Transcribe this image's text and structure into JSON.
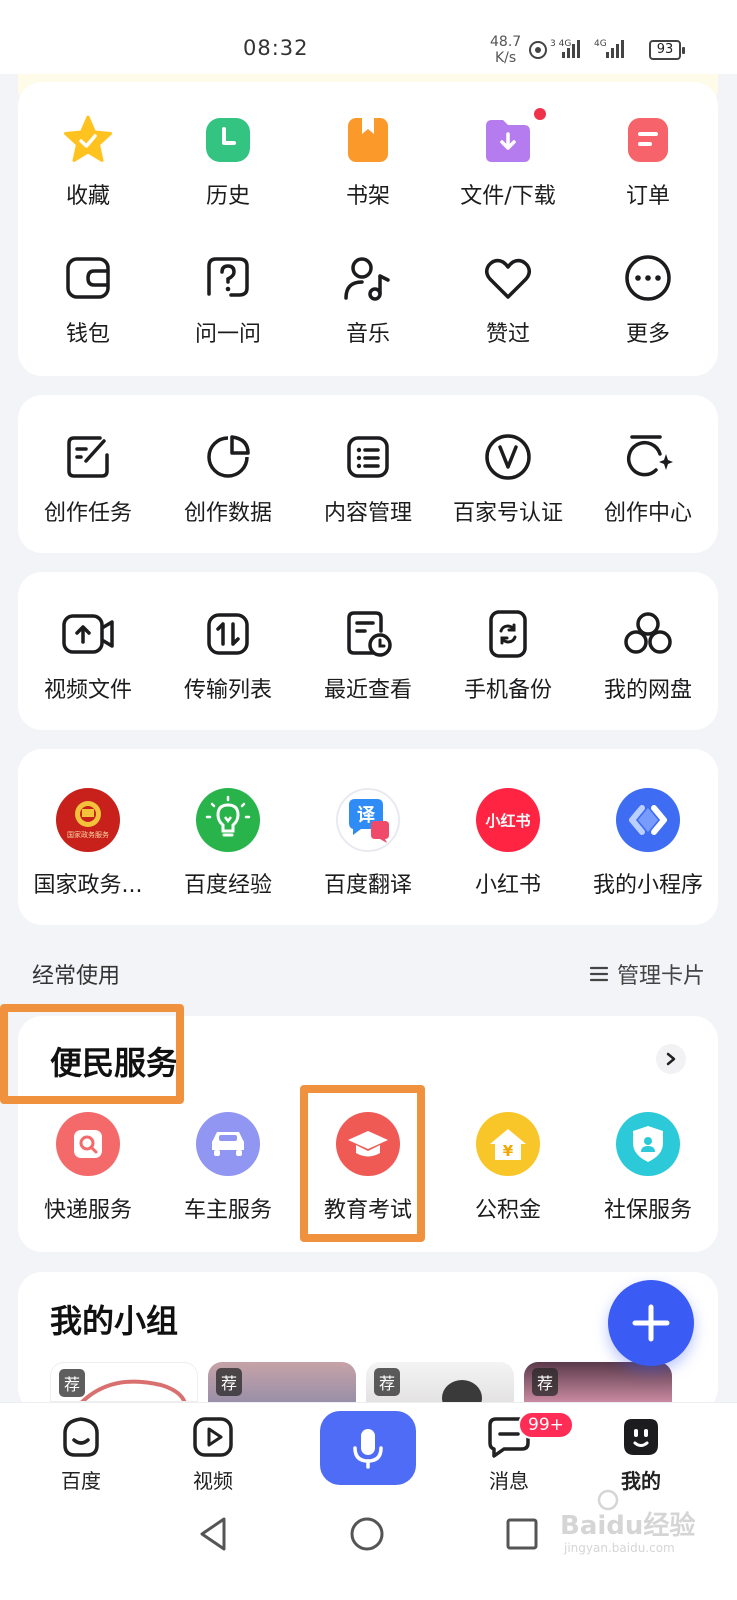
{
  "status_bar": {
    "time": "08:32",
    "speed_value": "48.7",
    "speed_unit": "K/s",
    "battery": "93"
  },
  "quick_menu": [
    {
      "label": "收藏",
      "icon": "star-icon"
    },
    {
      "label": "历史",
      "icon": "clock-icon"
    },
    {
      "label": "书架",
      "icon": "bookmark-icon"
    },
    {
      "label": "文件/下载",
      "icon": "download-folder-icon"
    },
    {
      "label": "订单",
      "icon": "order-icon"
    },
    {
      "label": "钱包",
      "icon": "wallet-icon"
    },
    {
      "label": "问一问",
      "icon": "question-icon"
    },
    {
      "label": "音乐",
      "icon": "music-icon"
    },
    {
      "label": "赞过",
      "icon": "heart-icon"
    },
    {
      "label": "更多",
      "icon": "more-icon"
    }
  ],
  "creation": [
    {
      "label": "创作任务",
      "icon": "edit-task-icon"
    },
    {
      "label": "创作数据",
      "icon": "pie-chart-icon"
    },
    {
      "label": "内容管理",
      "icon": "list-manage-icon"
    },
    {
      "label": "百家号认证",
      "icon": "verify-v-icon"
    },
    {
      "label": "创作中心",
      "icon": "creation-center-icon"
    }
  ],
  "netdisk": [
    {
      "label": "视频文件",
      "icon": "video-file-icon"
    },
    {
      "label": "传输列表",
      "icon": "transfer-icon"
    },
    {
      "label": "最近查看",
      "icon": "recent-icon"
    },
    {
      "label": "手机备份",
      "icon": "phone-backup-icon"
    },
    {
      "label": "我的网盘",
      "icon": "netdisk-icon"
    }
  ],
  "mini_programs": [
    {
      "label": "国家政务...",
      "icon": "emblem-icon",
      "logo_text": "国家政务服务"
    },
    {
      "label": "百度经验",
      "icon": "lightbulb-icon"
    },
    {
      "label": "百度翻译",
      "icon": "translate-icon",
      "logo_text": "译"
    },
    {
      "label": "小红书",
      "icon": "xiaohongshu-icon",
      "logo_text": "小红书"
    },
    {
      "label": "我的小程序",
      "icon": "mini-program-icon"
    }
  ],
  "frequent": {
    "title": "经常使用",
    "manage_label": "管理卡片"
  },
  "bianmin": {
    "title": "便民服务",
    "items": [
      {
        "label": "快递服务",
        "icon": "express-icon",
        "color": "#f35b5b"
      },
      {
        "label": "车主服务",
        "icon": "car-icon",
        "color": "#8b8ff2"
      },
      {
        "label": "教育考试",
        "icon": "graduation-cap-icon",
        "color": "#ef5350"
      },
      {
        "label": "公积金",
        "icon": "housing-fund-icon",
        "color": "#f7c325",
        "logo_text": "¥"
      },
      {
        "label": "社保服务",
        "icon": "social-security-icon",
        "color": "#26c6da"
      }
    ]
  },
  "groups": {
    "title": "我的小组",
    "tag": "荐"
  },
  "tabbar": {
    "items": [
      {
        "label": "百度",
        "icon": "baidu-face-icon"
      },
      {
        "label": "视频",
        "icon": "video-play-icon"
      },
      {
        "label": "消息",
        "icon": "message-icon"
      },
      {
        "label": "我的",
        "icon": "profile-icon"
      }
    ],
    "badge": "99+"
  },
  "watermark": {
    "text": "Baidu经验",
    "sub": "jingyan.baidu.com"
  }
}
